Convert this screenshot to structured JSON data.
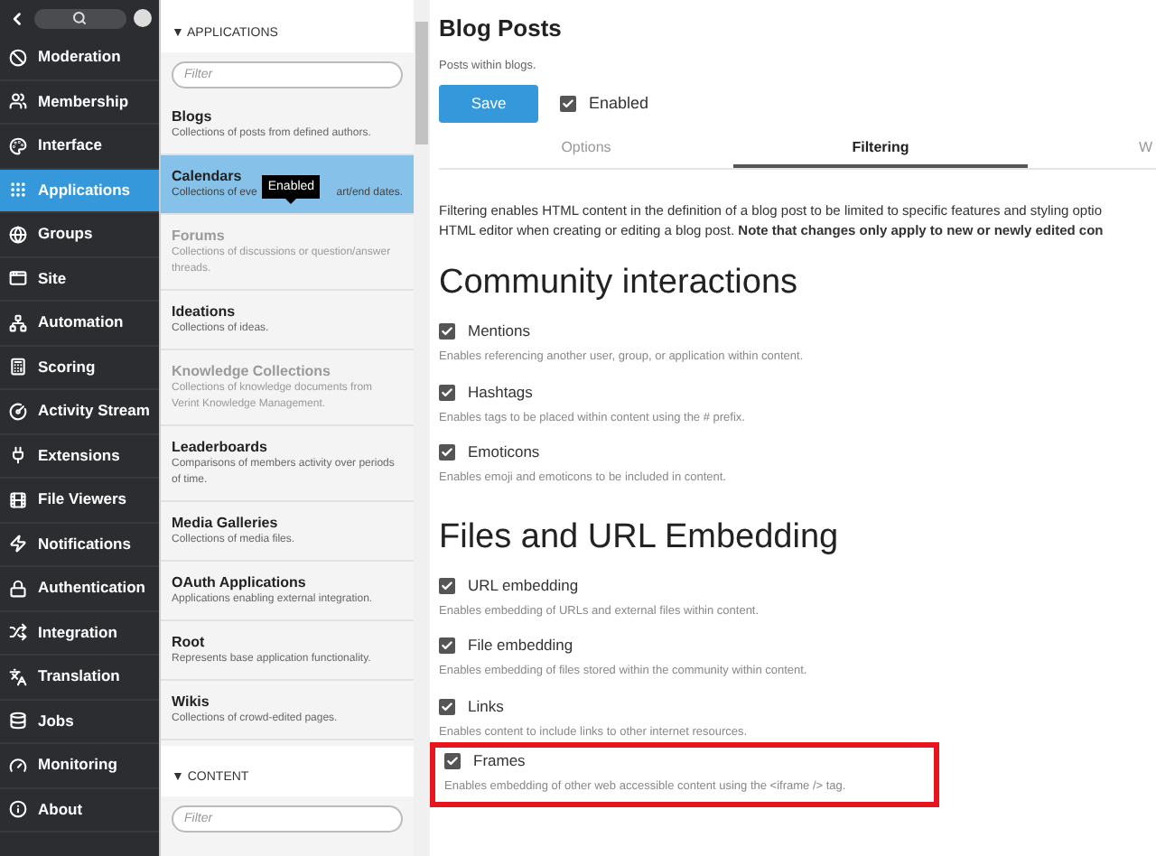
{
  "nav": {
    "items": [
      {
        "label": "Moderation",
        "selected": false
      },
      {
        "label": "Membership",
        "selected": false
      },
      {
        "label": "Interface",
        "selected": false
      },
      {
        "label": "Applications",
        "selected": true
      },
      {
        "label": "Groups",
        "selected": false
      },
      {
        "label": "Site",
        "selected": false
      },
      {
        "label": "Automation",
        "selected": false
      },
      {
        "label": "Scoring",
        "selected": false
      },
      {
        "label": "Activity Stream",
        "selected": false
      },
      {
        "label": "Extensions",
        "selected": false
      },
      {
        "label": "File Viewers",
        "selected": false
      },
      {
        "label": "Notifications",
        "selected": false
      },
      {
        "label": "Authentication",
        "selected": false
      },
      {
        "label": "Integration",
        "selected": false
      },
      {
        "label": "Translation",
        "selected": false
      },
      {
        "label": "Jobs",
        "selected": false
      },
      {
        "label": "Monitoring",
        "selected": false
      },
      {
        "label": "About",
        "selected": false
      }
    ]
  },
  "applications": {
    "header": "▼ APPLICATIONS",
    "filter": {
      "placeholder": "Filter"
    },
    "items": [
      {
        "name": "Blogs",
        "description": "Collections of posts from defined authors.",
        "selected": false,
        "disabled": false
      },
      {
        "name": "Calendars",
        "description_parts": [
          "Collections of eve",
          "art/end dates."
        ],
        "tooltip": "Enabled",
        "selected": true,
        "disabled": false
      },
      {
        "name": "Forums",
        "description": "Collections of discussions or question/answer threads.",
        "selected": false,
        "disabled": true
      },
      {
        "name": "Ideations",
        "description": "Collections of ideas.",
        "selected": false,
        "disabled": false
      },
      {
        "name": "Knowledge Collections",
        "description": "Collections of knowledge documents from Verint Knowledge Management.",
        "selected": false,
        "disabled": true
      },
      {
        "name": "Leaderboards",
        "description": "Comparisons of members activity over periods of time.",
        "selected": false,
        "disabled": false
      },
      {
        "name": "Media Galleries",
        "description": "Collections of media files.",
        "selected": false,
        "disabled": false
      },
      {
        "name": "OAuth Applications",
        "description": "Applications enabling external integration.",
        "selected": false,
        "disabled": false
      },
      {
        "name": "Root",
        "description": "Represents base application functionality.",
        "selected": false,
        "disabled": false
      },
      {
        "name": "Wikis",
        "description": "Collections of crowd-edited pages.",
        "selected": false,
        "disabled": false
      }
    ]
  },
  "content_section": {
    "header": "▼ CONTENT",
    "filter": {
      "placeholder": "Filter"
    }
  },
  "main": {
    "title": "Blog Posts",
    "subtitle": "Posts within blogs.",
    "save_button": "Save",
    "enabled": {
      "label": "Enabled",
      "checked": true
    },
    "tabs": [
      {
        "label": "Options",
        "selected": false
      },
      {
        "label": "Filtering",
        "selected": true
      },
      {
        "label": "W",
        "selected": false
      }
    ],
    "intro": [
      "Filtering enables HTML content in the definition of a blog post to be limited to specific features and styling optio",
      "HTML editor when creating or editing a blog post. **Note that changes only apply to new or newly edited con**"
    ],
    "sections": [
      {
        "heading": "Community interactions",
        "options": [
          {
            "label": "Mentions",
            "description": "Enables referencing another user, group, or application within content.",
            "checked": true,
            "highlighted": false
          },
          {
            "label": "Hashtags",
            "description": "Enables tags to be placed within content using the # prefix.",
            "checked": true,
            "highlighted": false
          },
          {
            "label": "Emoticons",
            "description": "Enables emoji and emoticons to be included in content.",
            "checked": true,
            "highlighted": false
          }
        ]
      },
      {
        "heading": "Files and URL Embedding",
        "options": [
          {
            "label": "URL embedding",
            "description": "Enables embedding of URLs and external files within content.",
            "checked": true,
            "highlighted": false
          },
          {
            "label": "File embedding",
            "description": "Enables embedding of files stored within the community within content.",
            "checked": true,
            "highlighted": false
          },
          {
            "label": "Links",
            "description": "Enables content to include links to other internet resources.",
            "checked": true,
            "highlighted": false
          },
          {
            "label": "Frames",
            "description": "Enables embedding of other web accessible content using the <iframe /> tag.",
            "checked": true,
            "highlighted": true
          }
        ]
      }
    ]
  }
}
